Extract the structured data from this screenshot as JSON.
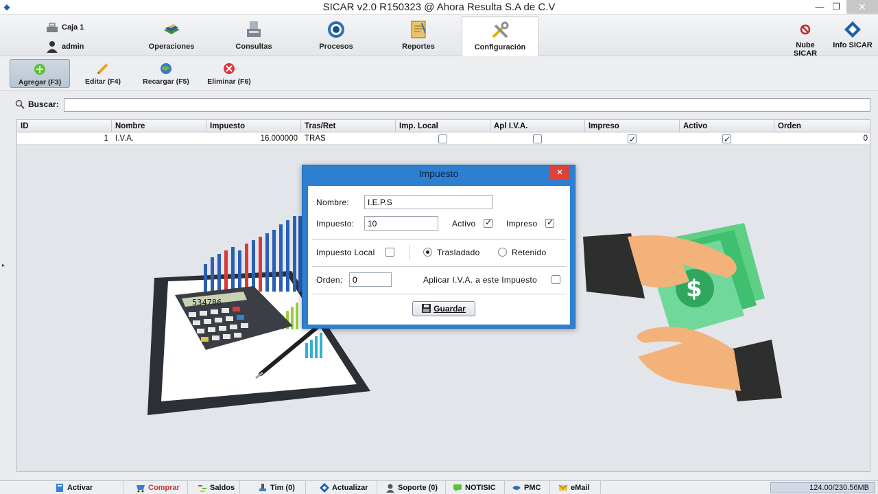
{
  "window": {
    "title": "SICAR v2.0 R150323 @ Ahora Resulta S.A de C.V"
  },
  "user": {
    "caja": "Caja 1",
    "username": "admin"
  },
  "nav": {
    "tabs": [
      {
        "label": "Operaciones",
        "icon": "operations-icon"
      },
      {
        "label": "Consultas",
        "icon": "consultas-icon"
      },
      {
        "label": "Procesos",
        "icon": "procesos-icon"
      },
      {
        "label": "Reportes",
        "icon": "reportes-icon"
      },
      {
        "label": "Configuración",
        "icon": "configuration-icon",
        "active": true
      }
    ],
    "nube": "Nube SICAR",
    "info": "Info SICAR"
  },
  "toolbar": {
    "add": "Agregar (F3)",
    "edit": "Editar (F4)",
    "reload": "Recargar (F5)",
    "delete": "Eliminar (F6)"
  },
  "search": {
    "label": "Buscar:",
    "value": ""
  },
  "table": {
    "columns": [
      "ID",
      "Nombre",
      "Impuesto",
      "Tras/Ret",
      "Imp. Local",
      "Apl I.V.A.",
      "Impreso",
      "Activo",
      "Orden"
    ],
    "rows": [
      {
        "id": "1",
        "nombre": "I.V.A.",
        "impuesto": "16.000000",
        "tras_ret": "TRAS",
        "imp_local": false,
        "apl_iva": false,
        "impreso": true,
        "activo": true,
        "orden": "0"
      }
    ]
  },
  "dialog": {
    "title": "Impuesto",
    "close": "✕",
    "nombre_label": "Nombre:",
    "nombre_value": "I.E.P.S",
    "impuesto_label": "Impuesto:",
    "impuesto_value": "10",
    "activo_label": "Activo",
    "activo_checked": true,
    "impreso_label": "Impreso",
    "impreso_checked": true,
    "impuesto_local_label": "Impuesto Local",
    "impuesto_local_checked": false,
    "trasladado_label": "Trasladado",
    "retenido_label": "Retenido",
    "selected_option": "Trasladado",
    "orden_label": "Orden:",
    "orden_value": "0",
    "aplicar_label": "Aplicar I.V.A. a este Impuesto",
    "aplicar_checked": false,
    "save_label": "Guardar",
    "calculator_display": "534786"
  },
  "statusbar": {
    "items": [
      "Activar",
      "Comprar",
      "Saldos",
      "Tim (0)",
      "Actualizar",
      "Soporte (0)",
      "NOTISIC",
      "PMC",
      "eMail"
    ],
    "memory": "124.00/230.56MB"
  },
  "colors": {
    "dialog_frame": "#2f7fd1",
    "close_red": "#d9433b",
    "comprar_red": "#c0392b",
    "money_green": "#3fbf6f"
  }
}
